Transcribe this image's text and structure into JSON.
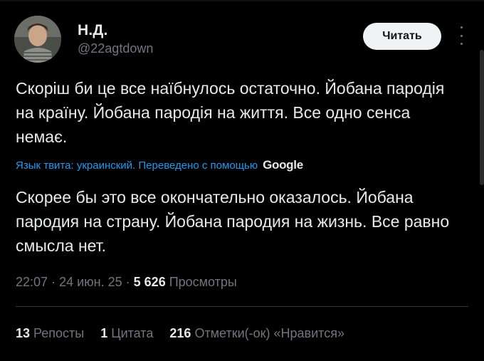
{
  "author": {
    "name": "Н.Д.",
    "handle": "@22agtdown"
  },
  "actions": {
    "read_label": "Читать",
    "more_icon": "more-vertical-icon"
  },
  "tweet": {
    "original_text": "Скоріш би це все наїбнулось остаточно. Йобана пародія на країну. Йобана пародія на життя. Все одно сенса немає.",
    "translation_note": "Язык твита: украинский. Переведено с помощью",
    "translation_provider": "Google",
    "translated_text": "Скорее бы это все окончательно оказалось. Йобана пародия на страну. Йобана пародия на жизнь. Все равно смысла нет."
  },
  "meta": {
    "time": "22:07",
    "separator": "·",
    "date": "24 июн. 25",
    "views_count": "5 626",
    "views_label": "Просмотры"
  },
  "stats": {
    "reposts_count": "13",
    "reposts_label": "Репосты",
    "quotes_count": "1",
    "quotes_label": "Цитата",
    "likes_count": "216",
    "likes_label": "Отметки(-ок) «Нравится»"
  },
  "colors": {
    "background": "#000000",
    "text": "#e7e9ea",
    "muted": "#71767b",
    "link": "#1d9bf0",
    "button_bg": "#eff3f4"
  }
}
